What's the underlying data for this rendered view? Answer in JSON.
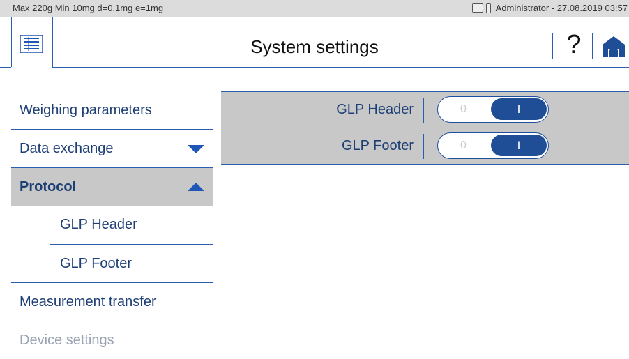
{
  "status": {
    "scale_specs": "Max 220g  Min 10mg  d=0.1mg  e=1mg",
    "user_time": "Administrator  -  27.08.2019 03:57"
  },
  "header": {
    "title": "System settings",
    "help_label": "?"
  },
  "sidebar": {
    "items": [
      {
        "label": "Weighing parameters"
      },
      {
        "label": "Data exchange"
      },
      {
        "label": "Protocol"
      },
      {
        "label": "GLP Header"
      },
      {
        "label": "GLP Footer"
      },
      {
        "label": "Measurement transfer"
      },
      {
        "label": "Device settings"
      }
    ]
  },
  "panel": {
    "rows": [
      {
        "label": "GLP Header",
        "off_label": "0",
        "on_label": "I",
        "state": "on"
      },
      {
        "label": "GLP Footer",
        "off_label": "0",
        "on_label": "I",
        "state": "on"
      }
    ]
  },
  "colors": {
    "accent": "#1f4e97",
    "line": "#2a5db0",
    "selected_bg": "#c8c8c8"
  }
}
